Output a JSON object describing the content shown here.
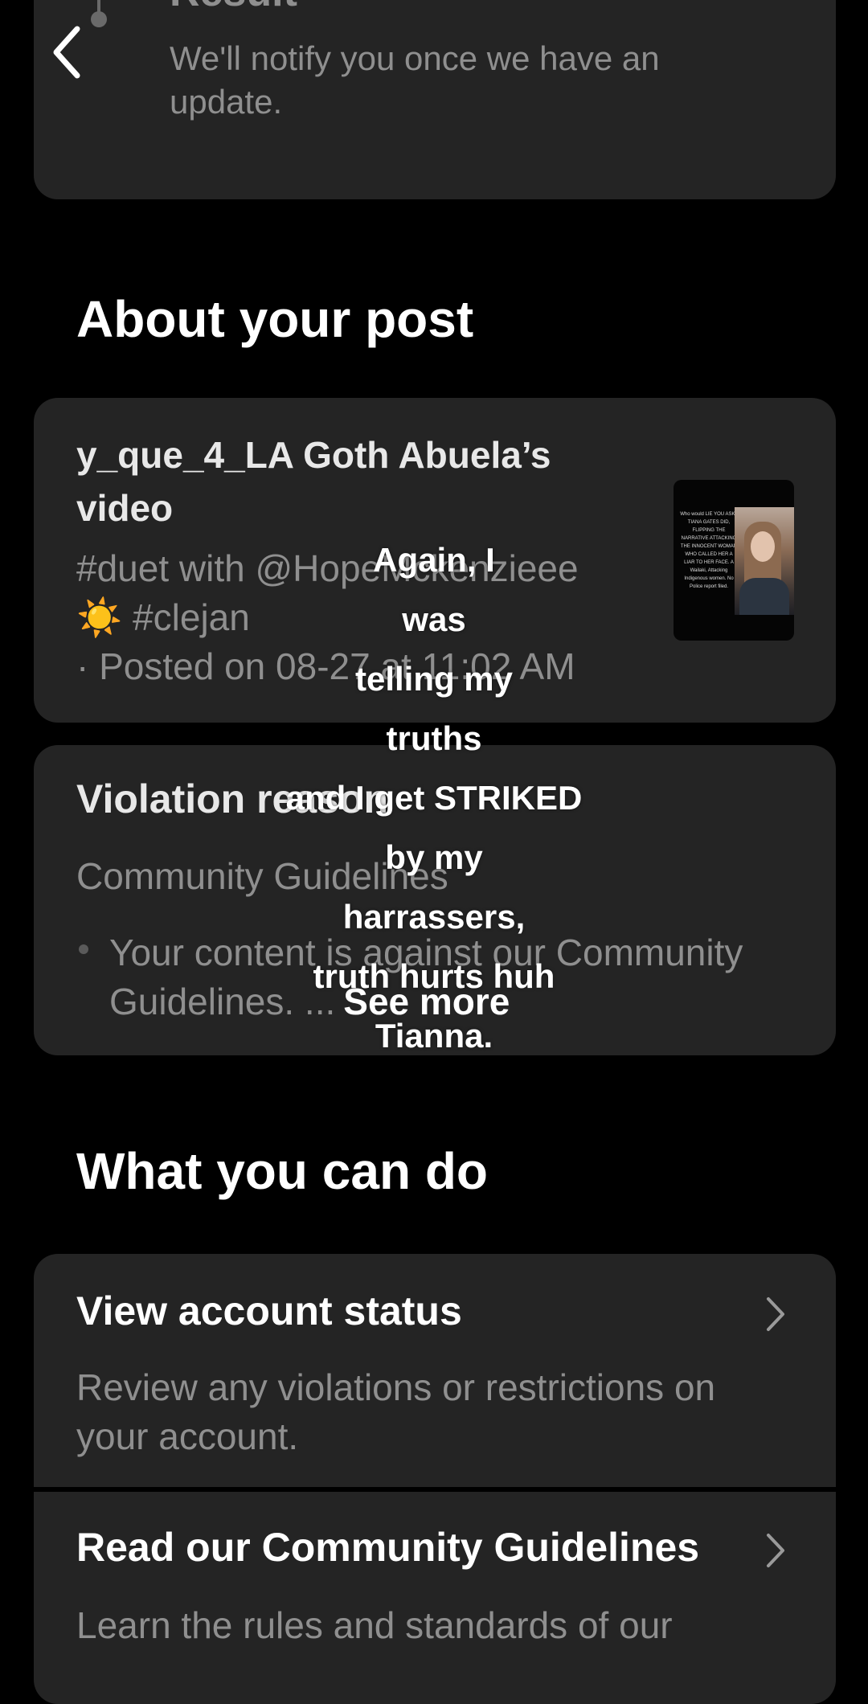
{
  "result": {
    "title": "Result",
    "description": "We'll notify you once we have an update."
  },
  "about": {
    "section_title": "About your post",
    "post_title": "y_que_4_LA Goth Abuela’s video",
    "caption_line1": "#duet with @HopeMckenzieee",
    "caption_line2": "☀️ #clejan",
    "caption_line3": "· Posted on 08-27 at 11:02 AM",
    "thumbnail_text": "Who would LIE YOU ASK? TIANA GATES DID, FLIPPING THE NARRATIVE ATTACKING THE INNOCENT WOMAN WHO CALLED HER A LIAR TO HER FACE. A Wailaki, Attacking Indigenous women. No Police report filed."
  },
  "violation": {
    "title": "Violation reason",
    "subtitle": "Community Guidelines",
    "description": "Your content is against our Community Guidelines. ...",
    "see_more": "See more"
  },
  "what_you_can_do": {
    "section_title": "What you can do",
    "actions": [
      {
        "title": "View account status",
        "description": "Review any violations or restrictions on your account."
      },
      {
        "title": "Read our Community Guidelines",
        "description": "Learn the rules and standards of our"
      }
    ]
  },
  "overlay_caption": {
    "lines": [
      "Again, I",
      "was",
      "telling my",
      "truths",
      "and I get STRIKED",
      "by my",
      "harrassers,",
      "truth hurts huh",
      "Tianna."
    ]
  },
  "icons": {
    "back": "chevron-left-icon",
    "chevron": "chevron-right-icon"
  },
  "colors": {
    "background": "#000000",
    "card": "#242424",
    "muted_text": "#8f8f8f",
    "primary_text": "#ffffff"
  }
}
